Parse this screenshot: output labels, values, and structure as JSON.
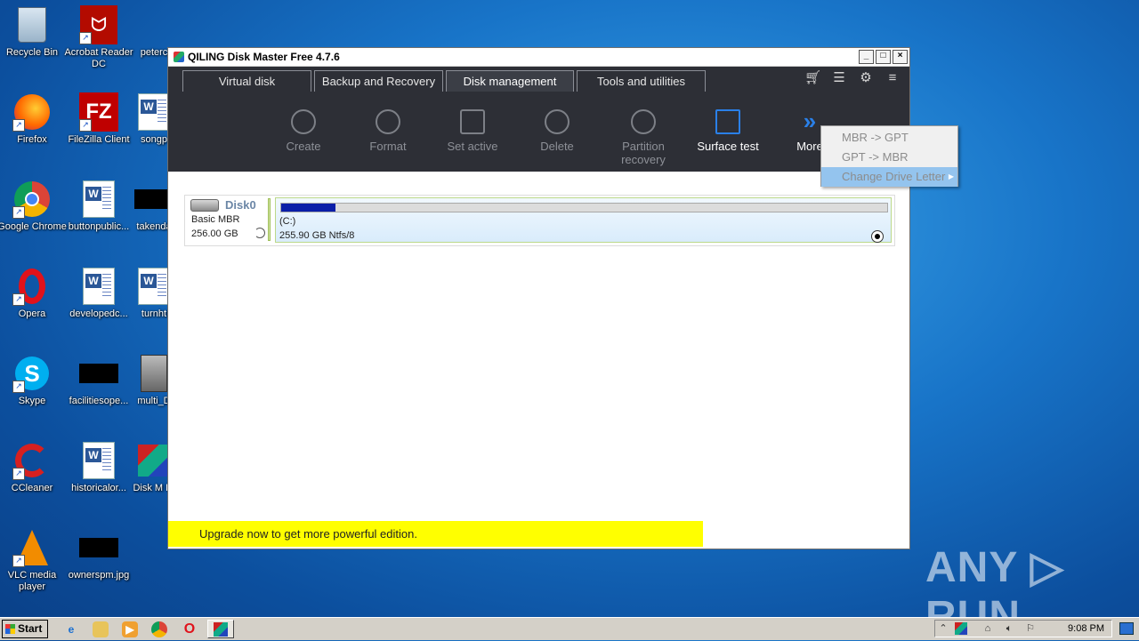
{
  "desktop": {
    "icons": [
      {
        "label": "Recycle Bin"
      },
      {
        "label": "Acrobat Reader DC"
      },
      {
        "label": "peterc"
      },
      {
        "label": "Firefox"
      },
      {
        "label": "FileZilla Client"
      },
      {
        "label": "songp"
      },
      {
        "label": "Google Chrome"
      },
      {
        "label": "buttonpublic..."
      },
      {
        "label": "takenda"
      },
      {
        "label": "Opera"
      },
      {
        "label": "developedc..."
      },
      {
        "label": "turnht"
      },
      {
        "label": "Skype"
      },
      {
        "label": "facilitiesope..."
      },
      {
        "label": "multi_D"
      },
      {
        "label": "CCleaner"
      },
      {
        "label": "historicalor..."
      },
      {
        "label": "Disk M Fr"
      },
      {
        "label": "VLC media player"
      },
      {
        "label": "ownerspm.jpg"
      }
    ]
  },
  "window": {
    "title": "QILING Disk Master Free 4.7.6",
    "buttons": {
      "minimize": "_",
      "maximize": "□",
      "close": "×"
    },
    "tabs": [
      {
        "label": "Virtual disk"
      },
      {
        "label": "Backup and Recovery"
      },
      {
        "label": "Disk management"
      },
      {
        "label": "Tools and utilities"
      }
    ],
    "active_tab": "Disk management",
    "toolbar": [
      {
        "label": "Create"
      },
      {
        "label": "Format"
      },
      {
        "label": "Set active"
      },
      {
        "label": "Delete"
      },
      {
        "label": "Partition recovery"
      },
      {
        "label": "Surface test"
      },
      {
        "label": "More"
      }
    ],
    "disk": {
      "name": "Disk0",
      "type": "Basic MBR",
      "size": "256.00 GB",
      "partition": {
        "label": "(C:)",
        "size": "255.90 GB Ntfs/8",
        "used_fraction": 0.09
      }
    },
    "upgrade_banner": "Upgrade now to get more powerful edition."
  },
  "context_menu": {
    "items": [
      {
        "label": "MBR -> GPT"
      },
      {
        "label": "GPT -> MBR"
      },
      {
        "label": "Change Drive Letter"
      }
    ]
  },
  "taskbar": {
    "start_label": "Start",
    "clock": "9:08 PM"
  },
  "watermark": "ANY ▷ RUN",
  "colors": {
    "accent": "#2a80e8",
    "toolbar_bg": "#2d2f36",
    "upgrade_bg": "#ffff00",
    "menu_highlight": "#94c4ee"
  }
}
